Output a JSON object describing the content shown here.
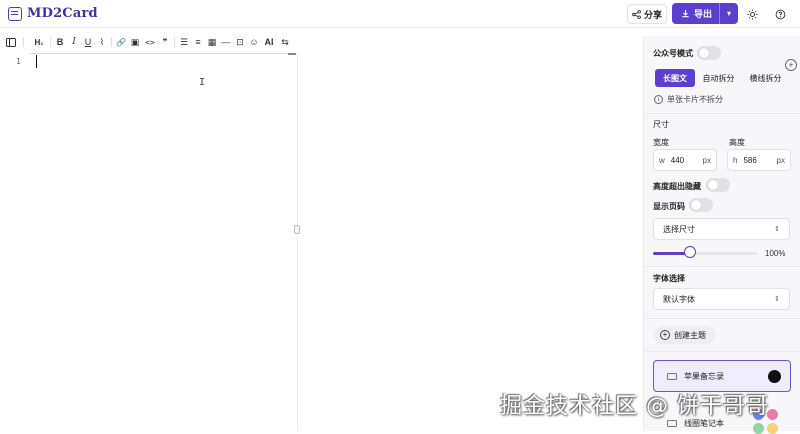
{
  "app": {
    "title": "MD2Card"
  },
  "header": {
    "share_label": "分享",
    "export_label": "导出",
    "export_caret": "▾",
    "icons": [
      "share-icon",
      "download-icon",
      "sun-icon",
      "help-icon"
    ]
  },
  "toolbar": {
    "items": [
      "H₁",
      "B",
      "I",
      "U",
      "⌇",
      "🔗",
      "▣",
      "<>",
      "❞",
      "☰",
      "≡",
      "▦",
      "―",
      "⊡",
      "☺",
      "AI",
      "⇆"
    ]
  },
  "editor": {
    "line_number": "1",
    "ibeam": "I"
  },
  "panel": {
    "wechat_mode_label": "公众号模式",
    "split_tabs": [
      {
        "label": "长图文",
        "active": true
      },
      {
        "label": "自动拆分",
        "active": false
      },
      {
        "label": "横线拆分",
        "active": false
      }
    ],
    "info_text": "单张卡片不拆分",
    "size_label": "尺寸",
    "width_label": "宽度",
    "height_label": "高度",
    "width_prefix": "w",
    "width_value": "440",
    "width_unit": "px",
    "height_prefix": "h",
    "height_value": "586",
    "height_unit": "px",
    "overflow_hidden_label": "高度超出隐藏",
    "show_page_label": "显示页码",
    "size_select": "选择尺寸",
    "zoom_value": "100%",
    "zoom_level": 0.36,
    "font_label": "字体选择",
    "font_select": "默认字体",
    "create_theme_label": "创建主题",
    "themes": [
      {
        "label": "苹果备忘录",
        "selected": true
      },
      {
        "label": "线圈笔记本",
        "selected": false
      }
    ],
    "colors": {
      "accent": "#5a3fd0",
      "swatch_black": "#111111",
      "swatch_blue": "#6b7ff0",
      "swatch_pink": "#f07aa8",
      "swatch_green": "#8fd6a0",
      "swatch_yellow": "#f5d27a"
    }
  },
  "watermark": "掘金技术社区 @ 饼干哥哥"
}
